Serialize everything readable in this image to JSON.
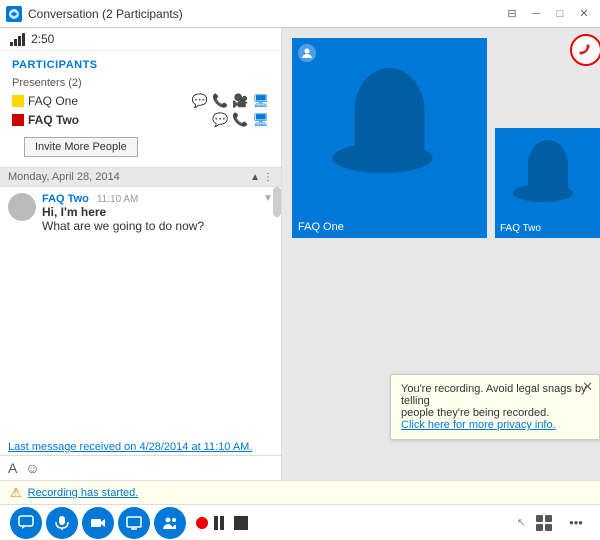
{
  "titlebar": {
    "title": "Conversation (2 Participants)",
    "controls": [
      "pin-icon",
      "minimize-icon",
      "maximize-icon",
      "close-icon"
    ]
  },
  "signal": {
    "time": "2:50"
  },
  "participants": {
    "header": "PARTICIPANTS",
    "presenters_label": "Presenters (2)",
    "list": [
      {
        "name": "FAQ One",
        "color": "#ffd700",
        "bold": false
      },
      {
        "name": "FAQ Two",
        "color": "#cc0000",
        "bold": true
      }
    ]
  },
  "invite_button": "Invite More People",
  "chat": {
    "date_header": "Monday, April 28, 2014",
    "message": {
      "sender": "FAQ Two",
      "time": "11:10 AM",
      "lines": [
        "Hi, I'm here",
        "What are we going to do now?"
      ]
    },
    "last_note": "Last message received on 4/28/2014 at 11:10 AM."
  },
  "video": {
    "main_name": "FAQ One",
    "small_name": "FAQ Two"
  },
  "end_call": "☎",
  "recording_notif": {
    "text1": "You're recording. Avoid legal snags by telling",
    "text2": "people they're being recorded.",
    "link_text": "Click here for more privacy info."
  },
  "recording_bar": {
    "icon": "⚠",
    "text": "Recording has started."
  },
  "toolbar": {
    "buttons": [
      "💬",
      "🎤",
      "📷",
      "🖥",
      "👥"
    ],
    "right_buttons": [
      "⊞",
      "•••"
    ]
  },
  "cursor": "↖"
}
